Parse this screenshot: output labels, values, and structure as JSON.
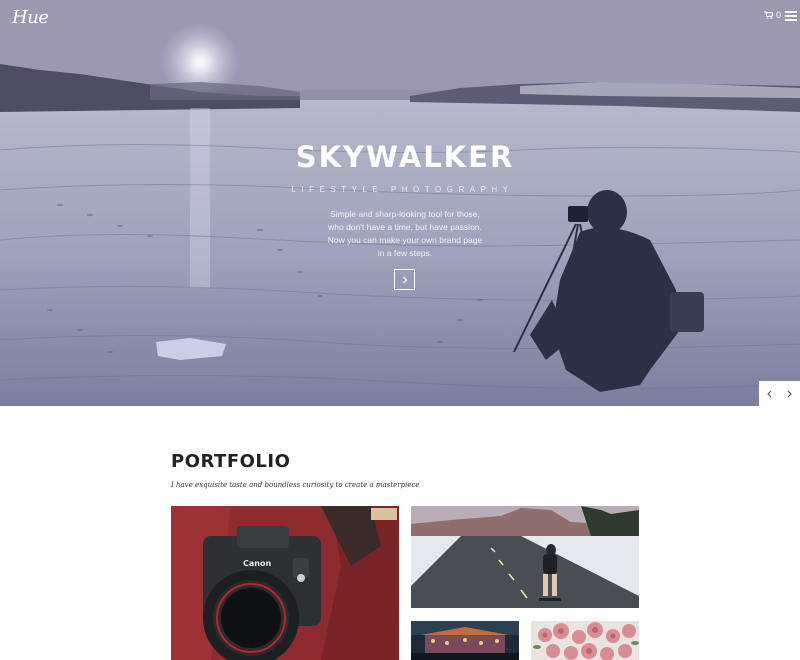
{
  "header": {
    "logo": "Hue",
    "cart_count": "0",
    "icons": {
      "cart": "cart-icon",
      "menu": "menu-icon"
    }
  },
  "hero": {
    "title": "SKYWALKER",
    "subtitle": "LIFESTYLE PHOTOGRAPHY",
    "description_lines": [
      "Simple and sharp-looking tool for those,",
      "who don't have a time, but have passion.",
      "Now you can make your own brand page",
      "in a few steps."
    ],
    "button_icon": "chevron-right-icon",
    "slider": {
      "prev_icon": "chevron-left-icon",
      "next_icon": "chevron-right-icon"
    }
  },
  "portfolio": {
    "title": "PORTFOLIO",
    "subtitle": "I have exquisite taste and boundless curiosity to create a masterpiece",
    "items": [
      "camera photo",
      "skateboarder on road",
      "night market",
      "pink roses"
    ]
  },
  "colors": {
    "hero_tint": "#9fa3bb",
    "text_dark": "#222222",
    "white": "#ffffff"
  }
}
